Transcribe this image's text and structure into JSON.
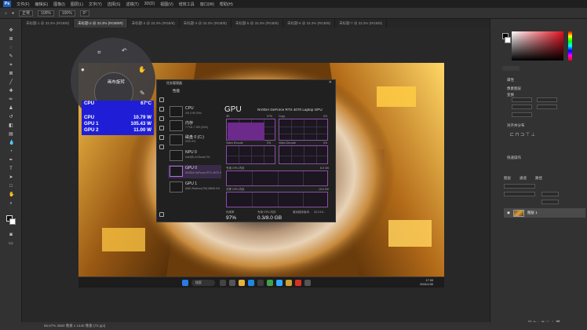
{
  "photoshop": {
    "logo": "Ps",
    "menus": [
      "文件(F)",
      "编辑(E)",
      "图像(I)",
      "图层(L)",
      "文字(Y)",
      "选择(S)",
      "滤镜(T)",
      "3D(D)",
      "视图(V)",
      "增效工具",
      "窗口(W)",
      "帮助(H)"
    ],
    "options": {
      "mode": "正常",
      "opacity": "100%",
      "flow": "100%",
      "angle": "0°"
    },
    "doc_tabs": [
      "未标题-1 @ 33.3% (RGB/8)",
      "未标题-2 @ 33.3% (RGB/8#)",
      "未标题-3 @ 33.3% (RGB/8)",
      "未标题-4 @ 33.3% (RGB/8)",
      "未标题-5 @ 33.3% (RGB/8)",
      "未标题-6 @ 33.3% (RGB/8)",
      "未标题-7 @ 33.3% (RGB/8)"
    ],
    "status": "66.67%   2560 像素 x 1440 像素 (72 ppi)",
    "layer_name": "图层 1",
    "right_labels": [
      "属性",
      "像素图层",
      "变换",
      "对齐并分布",
      "快速操作",
      "图层",
      "通道",
      "路径"
    ]
  },
  "overlay": {
    "hud_label": "画布旋转",
    "stats": [
      {
        "label": "CPU",
        "value": "67°C"
      },
      {
        "label": "CPU",
        "value": "10.79 W"
      },
      {
        "label": "GPU 1",
        "value": "105.43 W"
      },
      {
        "label": "GPU 2",
        "value": "11.00 W"
      }
    ]
  },
  "task_manager": {
    "title": "任务管理器",
    "header": "性能",
    "processes": [
      {
        "name": "CPU",
        "sub": "4% 3.99 GHz"
      },
      {
        "name": "内存",
        "sub": "7.7/31.7 GB (24%)"
      },
      {
        "name": "磁盘 0 (C:)",
        "sub": "SSD 0%"
      },
      {
        "name": "NPU 0",
        "sub": "Intel(R) AI Boost 0%"
      },
      {
        "name": "GPU 0",
        "sub": "NVIDIA GeForce RTX 4070 97% (67 °C)"
      },
      {
        "name": "GPU 1",
        "sub": "AMD Radeon(TM) 680M 0%"
      }
    ],
    "gpu_heading": "GPU",
    "gpu_model": "NVIDIA GeForce RTX 4070 Laptop GPU",
    "graph_labels": [
      "3D",
      "97%",
      "Copy",
      "0%",
      "Video Encode",
      "0%",
      "Video Decode",
      "0%",
      "专用 GPU 内存",
      "8.0 GB",
      "共享 GPU 内存",
      "15.8 GB"
    ],
    "summary": [
      {
        "label": "利用率",
        "value": "97%"
      },
      {
        "label": "专用 GPU 内存",
        "value": "0.3/8.0 GB"
      },
      {
        "label": "驱动程序版本:",
        "value": "32.0.15..."
      }
    ]
  },
  "taskbar": {
    "search": "搜索",
    "time": "17:39",
    "date": "2024/1/30"
  }
}
